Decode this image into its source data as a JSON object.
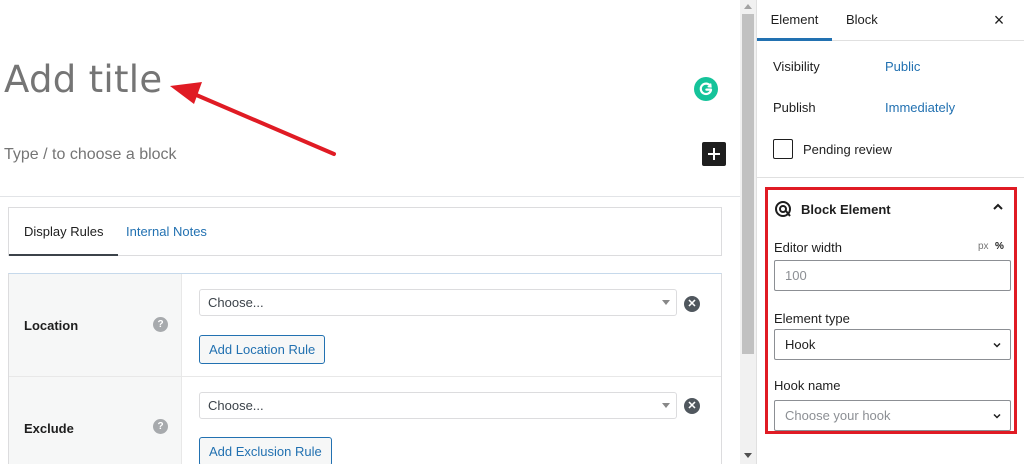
{
  "editor": {
    "title_placeholder": "Add title",
    "block_hint": "Type / to choose a block",
    "meta_tabs": [
      "Display Rules",
      "Internal Notes"
    ],
    "rules": [
      {
        "label": "Location",
        "select_value": "Choose...",
        "button": "Add Location Rule"
      },
      {
        "label": "Exclude",
        "select_value": "Choose...",
        "button": "Add Exclusion Rule"
      }
    ],
    "help_glyph": "?",
    "remove_glyph": "✕"
  },
  "sidebar": {
    "tabs": [
      "Element",
      "Block"
    ],
    "close_glyph": "×",
    "visibility_label": "Visibility",
    "visibility_value": "Public",
    "publish_label": "Publish",
    "publish_value": "Immediately",
    "pending_label": "Pending review",
    "panel": {
      "title": "Block Element",
      "editor_width_label": "Editor width",
      "unit_px": "px",
      "unit_percent": "%",
      "editor_width_placeholder": "100",
      "element_type_label": "Element type",
      "element_type_value": "Hook",
      "hook_name_label": "Hook name",
      "hook_name_placeholder": "Choose your hook"
    }
  },
  "colors": {
    "accent": "#2271b1",
    "highlight_border": "#e01b24",
    "annotation_arrow": "#e01b24",
    "grammarly": "#15c39a"
  },
  "icons": [
    "grammarly-icon",
    "plus-icon",
    "help-icon",
    "remove-icon",
    "block-element-icon",
    "chevron-up-icon",
    "chevron-down-icon",
    "close-icon"
  ]
}
